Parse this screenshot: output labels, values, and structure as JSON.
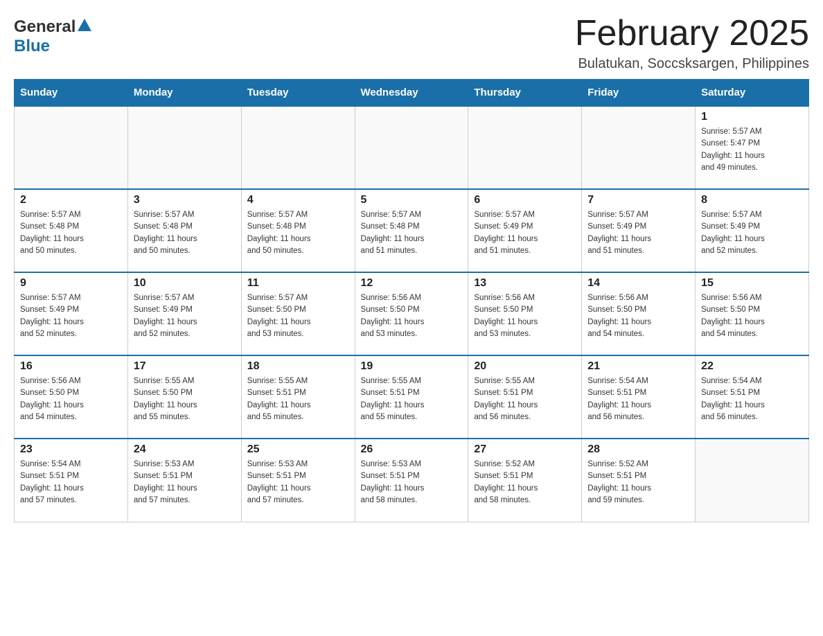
{
  "header": {
    "logo": {
      "general": "General",
      "blue": "Blue"
    },
    "title": "February 2025",
    "subtitle": "Bulatukan, Soccsksargen, Philippines"
  },
  "weekdays": [
    "Sunday",
    "Monday",
    "Tuesday",
    "Wednesday",
    "Thursday",
    "Friday",
    "Saturday"
  ],
  "weeks": [
    {
      "days": [
        {
          "number": "",
          "info": "",
          "empty": true
        },
        {
          "number": "",
          "info": "",
          "empty": true
        },
        {
          "number": "",
          "info": "",
          "empty": true
        },
        {
          "number": "",
          "info": "",
          "empty": true
        },
        {
          "number": "",
          "info": "",
          "empty": true
        },
        {
          "number": "",
          "info": "",
          "empty": true
        },
        {
          "number": "1",
          "info": "Sunrise: 5:57 AM\nSunset: 5:47 PM\nDaylight: 11 hours\nand 49 minutes.",
          "empty": false
        }
      ]
    },
    {
      "days": [
        {
          "number": "2",
          "info": "Sunrise: 5:57 AM\nSunset: 5:48 PM\nDaylight: 11 hours\nand 50 minutes.",
          "empty": false
        },
        {
          "number": "3",
          "info": "Sunrise: 5:57 AM\nSunset: 5:48 PM\nDaylight: 11 hours\nand 50 minutes.",
          "empty": false
        },
        {
          "number": "4",
          "info": "Sunrise: 5:57 AM\nSunset: 5:48 PM\nDaylight: 11 hours\nand 50 minutes.",
          "empty": false
        },
        {
          "number": "5",
          "info": "Sunrise: 5:57 AM\nSunset: 5:48 PM\nDaylight: 11 hours\nand 51 minutes.",
          "empty": false
        },
        {
          "number": "6",
          "info": "Sunrise: 5:57 AM\nSunset: 5:49 PM\nDaylight: 11 hours\nand 51 minutes.",
          "empty": false
        },
        {
          "number": "7",
          "info": "Sunrise: 5:57 AM\nSunset: 5:49 PM\nDaylight: 11 hours\nand 51 minutes.",
          "empty": false
        },
        {
          "number": "8",
          "info": "Sunrise: 5:57 AM\nSunset: 5:49 PM\nDaylight: 11 hours\nand 52 minutes.",
          "empty": false
        }
      ]
    },
    {
      "days": [
        {
          "number": "9",
          "info": "Sunrise: 5:57 AM\nSunset: 5:49 PM\nDaylight: 11 hours\nand 52 minutes.",
          "empty": false
        },
        {
          "number": "10",
          "info": "Sunrise: 5:57 AM\nSunset: 5:49 PM\nDaylight: 11 hours\nand 52 minutes.",
          "empty": false
        },
        {
          "number": "11",
          "info": "Sunrise: 5:57 AM\nSunset: 5:50 PM\nDaylight: 11 hours\nand 53 minutes.",
          "empty": false
        },
        {
          "number": "12",
          "info": "Sunrise: 5:56 AM\nSunset: 5:50 PM\nDaylight: 11 hours\nand 53 minutes.",
          "empty": false
        },
        {
          "number": "13",
          "info": "Sunrise: 5:56 AM\nSunset: 5:50 PM\nDaylight: 11 hours\nand 53 minutes.",
          "empty": false
        },
        {
          "number": "14",
          "info": "Sunrise: 5:56 AM\nSunset: 5:50 PM\nDaylight: 11 hours\nand 54 minutes.",
          "empty": false
        },
        {
          "number": "15",
          "info": "Sunrise: 5:56 AM\nSunset: 5:50 PM\nDaylight: 11 hours\nand 54 minutes.",
          "empty": false
        }
      ]
    },
    {
      "days": [
        {
          "number": "16",
          "info": "Sunrise: 5:56 AM\nSunset: 5:50 PM\nDaylight: 11 hours\nand 54 minutes.",
          "empty": false
        },
        {
          "number": "17",
          "info": "Sunrise: 5:55 AM\nSunset: 5:50 PM\nDaylight: 11 hours\nand 55 minutes.",
          "empty": false
        },
        {
          "number": "18",
          "info": "Sunrise: 5:55 AM\nSunset: 5:51 PM\nDaylight: 11 hours\nand 55 minutes.",
          "empty": false
        },
        {
          "number": "19",
          "info": "Sunrise: 5:55 AM\nSunset: 5:51 PM\nDaylight: 11 hours\nand 55 minutes.",
          "empty": false
        },
        {
          "number": "20",
          "info": "Sunrise: 5:55 AM\nSunset: 5:51 PM\nDaylight: 11 hours\nand 56 minutes.",
          "empty": false
        },
        {
          "number": "21",
          "info": "Sunrise: 5:54 AM\nSunset: 5:51 PM\nDaylight: 11 hours\nand 56 minutes.",
          "empty": false
        },
        {
          "number": "22",
          "info": "Sunrise: 5:54 AM\nSunset: 5:51 PM\nDaylight: 11 hours\nand 56 minutes.",
          "empty": false
        }
      ]
    },
    {
      "days": [
        {
          "number": "23",
          "info": "Sunrise: 5:54 AM\nSunset: 5:51 PM\nDaylight: 11 hours\nand 57 minutes.",
          "empty": false
        },
        {
          "number": "24",
          "info": "Sunrise: 5:53 AM\nSunset: 5:51 PM\nDaylight: 11 hours\nand 57 minutes.",
          "empty": false
        },
        {
          "number": "25",
          "info": "Sunrise: 5:53 AM\nSunset: 5:51 PM\nDaylight: 11 hours\nand 57 minutes.",
          "empty": false
        },
        {
          "number": "26",
          "info": "Sunrise: 5:53 AM\nSunset: 5:51 PM\nDaylight: 11 hours\nand 58 minutes.",
          "empty": false
        },
        {
          "number": "27",
          "info": "Sunrise: 5:52 AM\nSunset: 5:51 PM\nDaylight: 11 hours\nand 58 minutes.",
          "empty": false
        },
        {
          "number": "28",
          "info": "Sunrise: 5:52 AM\nSunset: 5:51 PM\nDaylight: 11 hours\nand 59 minutes.",
          "empty": false
        },
        {
          "number": "",
          "info": "",
          "empty": true
        }
      ]
    }
  ]
}
